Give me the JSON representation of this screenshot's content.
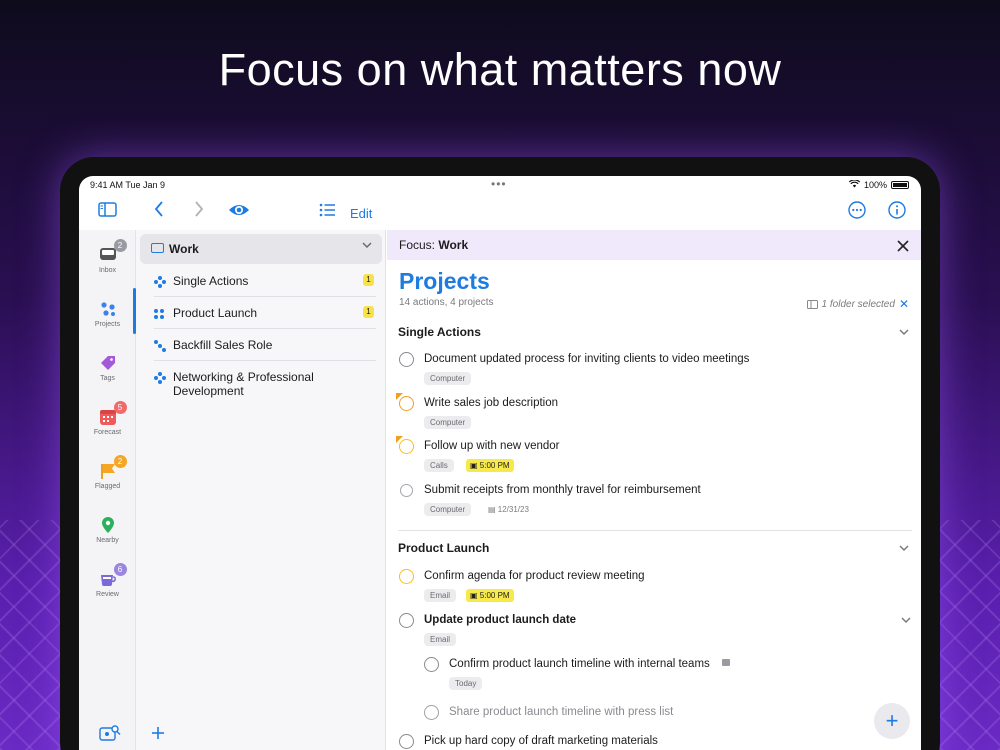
{
  "headline": "Focus on what matters now",
  "status": {
    "time": "9:41 AM   Tue Jan 9",
    "battery": "100%"
  },
  "toolbar": {
    "edit_label": "Edit"
  },
  "rail": [
    {
      "label": "Inbox",
      "badge": "2",
      "badge_color": "#9a9aa2"
    },
    {
      "label": "Projects",
      "badge": "",
      "badge_color": ""
    },
    {
      "label": "Tags",
      "badge": "",
      "badge_color": ""
    },
    {
      "label": "Forecast",
      "badge": "5",
      "badge_color": "#f06a6a"
    },
    {
      "label": "Flagged",
      "badge": "2",
      "badge_color": "#f5a623"
    },
    {
      "label": "Nearby",
      "badge": "",
      "badge_color": ""
    },
    {
      "label": "Review",
      "badge": "6",
      "badge_color": "#9a86e0"
    }
  ],
  "sidebar": {
    "folder": "Work",
    "items": [
      {
        "label": "Single Actions",
        "count": "1"
      },
      {
        "label": "Product Launch",
        "count": "1"
      },
      {
        "label": "Backfill Sales Role",
        "count": ""
      },
      {
        "label": "Networking & Professional Development",
        "count": ""
      }
    ]
  },
  "main": {
    "focus_prefix": "Focus:",
    "focus_name": "Work",
    "title": "Projects",
    "subtitle": "14 actions, 4 projects",
    "folder_selected": "1 folder selected",
    "sections": [
      {
        "name": "Single Actions",
        "tasks": [
          {
            "title": "Document updated process for inviting clients to video meetings",
            "tag": "Computer",
            "due": "",
            "date": ""
          },
          {
            "title": "Write sales job description",
            "tag": "Computer",
            "due": "",
            "date": ""
          },
          {
            "title": "Follow up with new vendor",
            "tag": "Calls",
            "due": "5:00 PM",
            "date": ""
          },
          {
            "title": "Submit receipts from monthly travel for reimbursement",
            "tag": "Computer",
            "due": "",
            "date": "12/31/23"
          }
        ]
      },
      {
        "name": "Product Launch",
        "tasks": [
          {
            "title": "Confirm agenda for product review meeting",
            "tag": "Email",
            "due": "5:00 PM",
            "date": ""
          },
          {
            "title": "Update product launch date",
            "tag": "Email",
            "due": "",
            "date": ""
          },
          {
            "title": "Confirm product launch timeline with internal teams",
            "tag": "Today",
            "due": "",
            "date": ""
          },
          {
            "title": "Share product launch timeline with press list",
            "tag": "",
            "due": "",
            "date": ""
          },
          {
            "title": "Pick up hard copy of draft marketing materials",
            "tag": "",
            "due": "",
            "date": ""
          }
        ]
      }
    ]
  },
  "colors": {
    "accent": "#1e7be0",
    "focus_bar": "#efe9fb",
    "due_highlight": "#f7e94a",
    "flag": "#f0a020"
  }
}
